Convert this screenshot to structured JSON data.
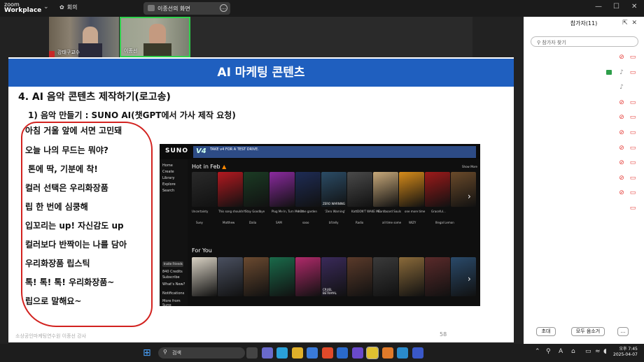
{
  "app": {
    "logo_line1": "zoom",
    "logo_line2": "Workplace",
    "meeting_label": "회의",
    "share_title": "이종선의 화면"
  },
  "videos": [
    {
      "name": "강태구교수"
    },
    {
      "name": "이종선"
    }
  ],
  "slide": {
    "header": "AI 마케팅 콘텐츠",
    "heading": "4. AI 음악 콘텐츠 제작하기(로고송)",
    "subheading": "1) 음악 만들기 : SUNO AI(챗GPT에서 가사 제작 요청)",
    "lyrics": [
      "아침 거울 앞에 서면 고민돼",
      "오늘 나의 무드는 뭐야?",
      "톤에 딱, 기분에 착!",
      "컬러 선택은 우리화장품",
      "립 한 번에 심쿵해",
      "입꼬리는 up! 자신감도 up",
      "컬러보다 반짝이는 나를 담아",
      "우리화장품 립스틱",
      "톡! 톡! 톡! 우리화장품~",
      "립으로 말해요~"
    ],
    "footer": "소상공인마케팅연수원 이종선 강사",
    "page_number": "58"
  },
  "suno": {
    "logo": "SUNO",
    "banner_version": "V4",
    "banner_text": "TAKE v4 FOR A TEST DRIVE.",
    "side_items": [
      "Home",
      "Create",
      "Library",
      "Explore",
      "Search"
    ],
    "side_button": "Invite Friends",
    "side_credits": "840 Credits",
    "side_lower": [
      "Subscribe",
      "What's New?",
      "Notifications",
      "More from Suno"
    ],
    "section1": "Hot in Feb",
    "section2": "For You",
    "show_more": "Show More",
    "row1_titles": [
      "Uncertainty",
      "This song shouldn't",
      "Stay Goodbye",
      "Plug Me In, Turn Me On",
      "In the garden",
      "'Zero Warning'",
      "KattDON'T WAKE ME",
      "Cardboard Souls",
      "one more time",
      "Graceful..."
    ],
    "row1_users": [
      "Suey",
      "Matthew",
      "Dalia",
      "SAM",
      "sooo",
      "bf.telly",
      "Radio",
      "all time some",
      "WIZY",
      "Illegal Lemon"
    ],
    "row2_card_label": "CRUEL BETRAYAL",
    "row1_card_label": "ZERO WARNING",
    "row1_colors": [
      "#2a2a2a",
      "#b31920",
      "#1b3b24",
      "#8a2a9e",
      "#1e2c55",
      "#2b4c66",
      "#4a4a4a",
      "#c8a97a",
      "#d68b1a",
      "#9d1a1a",
      "#6a4a2a",
      "#2a7a3a"
    ],
    "row2_colors": [
      "#d9d2c4",
      "#4a5060",
      "#6b4a30",
      "#1a6a4a",
      "#b02a6a",
      "#3a2a5a",
      "#5a3a2a",
      "#3a3a3a",
      "#8a6a3a",
      "#5a2a2a",
      "#2a4a6a",
      "#4a3a2a"
    ]
  },
  "panel": {
    "title": "참가자(11)",
    "search_placeholder": "참가자 찾기",
    "rows": [
      {
        "mic": "off",
        "cam": "off"
      },
      {
        "share": true,
        "mic": "on",
        "cam": "off"
      },
      {
        "mic": "on",
        "cam": "none"
      },
      {
        "mic": "off",
        "cam": "off"
      },
      {
        "mic": "off",
        "cam": "off"
      },
      {
        "mic": "off",
        "cam": "off"
      },
      {
        "mic": "off",
        "cam": "off"
      },
      {
        "mic": "off",
        "cam": "off"
      },
      {
        "mic": "off",
        "cam": "off"
      },
      {
        "mic": "off",
        "cam": "off"
      },
      {
        "mic": "none",
        "cam": "off"
      }
    ],
    "invite_label": "초대",
    "mute_all_label": "모두 음소거",
    "more_label": "..."
  },
  "taskbar": {
    "search_label": "검색",
    "time": "오후 7:45",
    "date": "2025-04-07",
    "app_colors": [
      "#444",
      "#6a6acb",
      "#2aa0d8",
      "#e0b02a",
      "#3a7ad8",
      "#e04a2a",
      "#2a6acb",
      "#6a4acb",
      "#e0c030",
      "#e07a2a",
      "#2a8acb",
      "#3a58c8"
    ],
    "accent": "#1f5fbf",
    "red_outline": "#d2221f"
  }
}
